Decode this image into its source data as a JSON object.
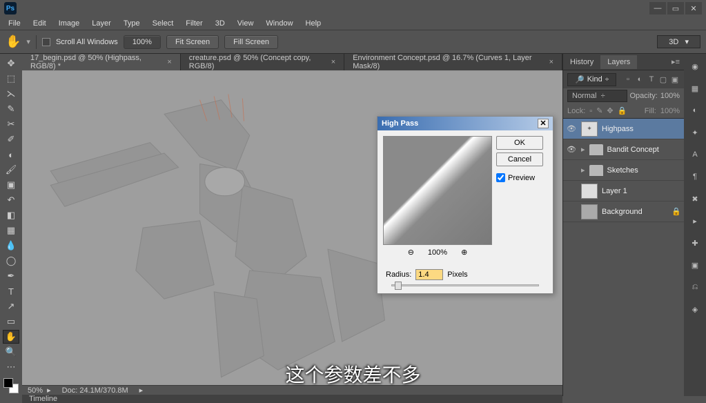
{
  "menubar": {
    "file": "File",
    "edit": "Edit",
    "image": "Image",
    "layer": "Layer",
    "type": "Type",
    "select": "Select",
    "filter": "Filter",
    "threeD": "3D",
    "view": "View",
    "window": "Window",
    "help": "Help"
  },
  "optbar": {
    "scroll": "Scroll All Windows",
    "zoom": "100%",
    "fit": "Fit Screen",
    "fill": "Fill Screen",
    "threeD": "3D"
  },
  "tabs": {
    "t1": "17_begin.psd @ 50% (Highpass, RGB/8) *",
    "t2": "creature.psd @ 50% (Concept copy, RGB/8)",
    "t3": "Environment Concept.psd @ 16.7% (Curves 1, Layer Mask/8)"
  },
  "status": {
    "zoom": "50%",
    "doc": "Doc: 24.1M/370.8M",
    "timeline": "Timeline"
  },
  "panels": {
    "history": "History",
    "layers": "Layers",
    "kind": "Kind",
    "blend": "Normal",
    "opacityL": "Opacity:",
    "opacity": "100%",
    "lock": "Lock:",
    "fillL": "Fill:",
    "fill": "100%"
  },
  "layers": {
    "l1": "Highpass",
    "l2": "Bandit Concept",
    "l3": "Sketches",
    "l4": "Layer 1",
    "l5": "Background"
  },
  "dialog": {
    "title": "High Pass",
    "ok": "OK",
    "cancel": "Cancel",
    "preview": "Preview",
    "zoom": "100%",
    "radiusL": "Radius:",
    "radius": "1.4",
    "pixels": "Pixels"
  },
  "subtitle": "这个参数差不多"
}
